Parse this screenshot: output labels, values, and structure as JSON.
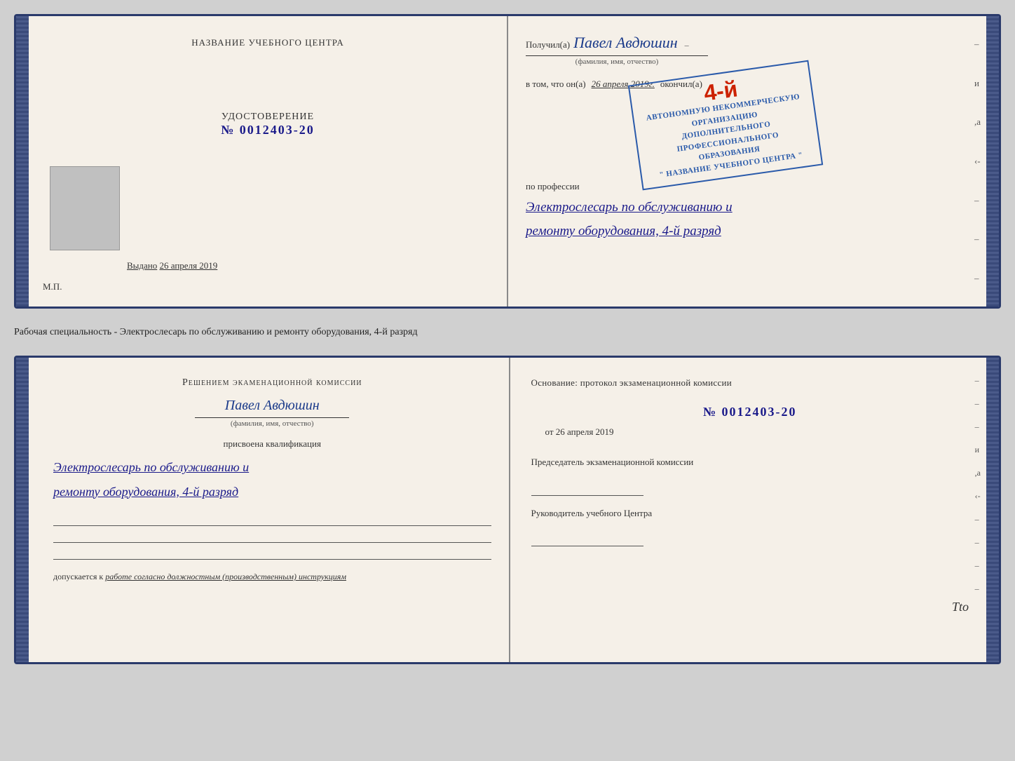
{
  "top_doc": {
    "left": {
      "title": "НАЗВАНИЕ УЧЕБНОГО ЦЕНТРА",
      "cert_label": "УДОСТОВЕРЕНИЕ",
      "cert_number": "№ 0012403-20",
      "issued_label": "Выдано",
      "issued_date": "26 апреля 2019",
      "mp_label": "М.П."
    },
    "right": {
      "received_label": "Получил(а)",
      "person_name": "Павел Авдюшин",
      "fio_label": "(фамилия, имя, отчество)",
      "in_that_prefix": "в том, что он(а)",
      "completed_date": "26 апреля 2019г.",
      "completed_label": "окончил(а)",
      "stamp_number": "4-й",
      "stamp_line1": "АВТОНОМНУЮ НЕКОММЕРЧЕСКУЮ ОРГАНИЗАЦИЮ",
      "stamp_line2": "ДОПОЛНИТЕЛЬНОГО ПРОФЕССИОНАЛЬНОГО ОБРАЗОВАНИЯ",
      "stamp_line3": "\" НАЗВАНИЕ УЧЕБНОГО ЦЕНТРА \"",
      "profession_label": "по профессии",
      "profession_line1": "Электрослесарь по обслуживанию и",
      "profession_line2": "ремонту оборудования, 4-й разряд"
    }
  },
  "middle_text": "Рабочая специальность - Электрослесарь по обслуживанию и ремонту оборудования, 4-й разряд",
  "bottom_doc": {
    "left": {
      "commission_text": "Решением экаменационной комиссии",
      "person_name": "Павел Авдюшин",
      "fio_label": "(фамилия, имя, отчество)",
      "assigned_label": "присвоена квалификация",
      "qualification_line1": "Электрослесарь по обслуживанию и",
      "qualification_line2": "ремонту оборудования, 4-й разряд",
      "allowed_prefix": "допускается к",
      "allowed_italic": "работе согласно должностным (производственным) инструкциям"
    },
    "right": {
      "basis_text": "Основание: протокол экзаменационной комиссии",
      "protocol_number": "№ 0012403-20",
      "date_prefix": "от",
      "protocol_date": "26 апреля 2019",
      "chairman_role": "Председатель экзаменационной комиссии",
      "director_role": "Руководитель учебного Центра"
    }
  },
  "tto_mark": "Tto"
}
